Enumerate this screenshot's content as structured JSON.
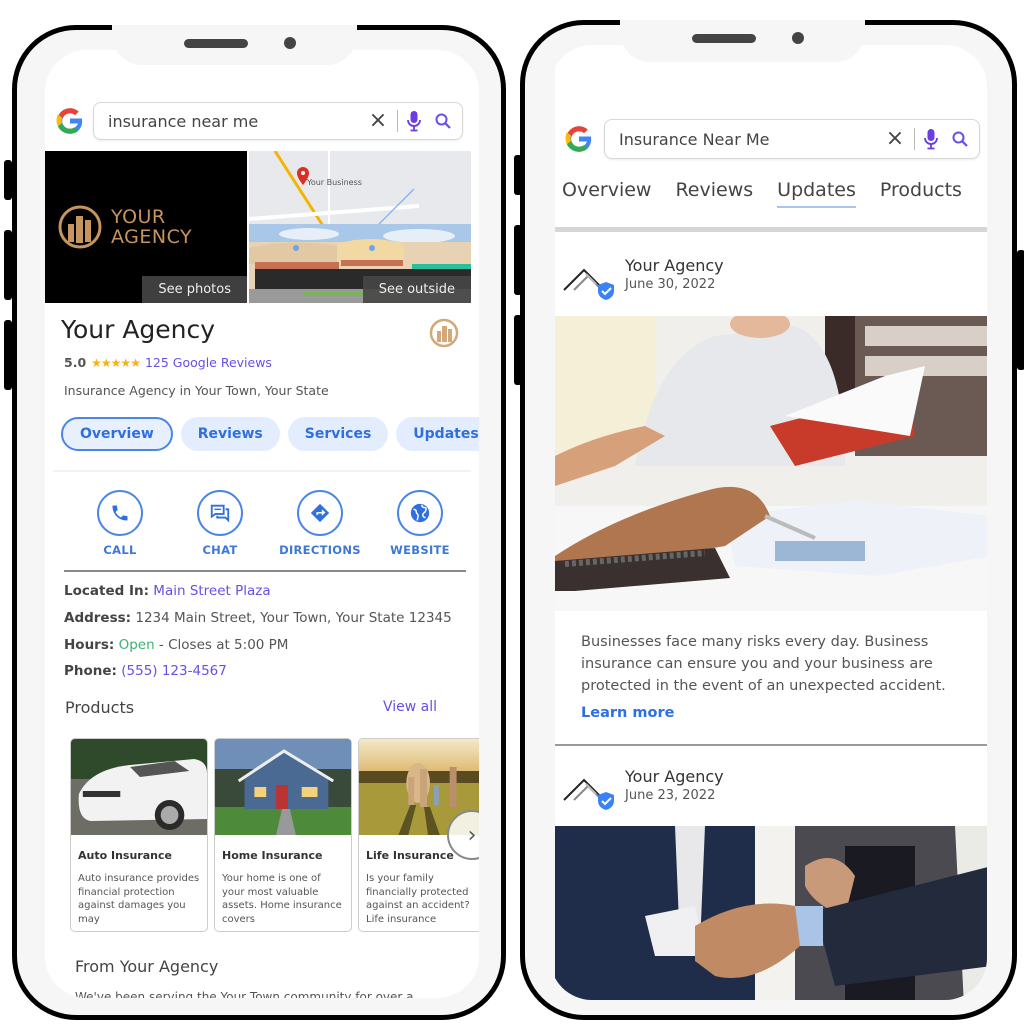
{
  "left_phone": {
    "search": {
      "query": "insurance near me"
    },
    "photos": {
      "logo_line1": "YOUR",
      "logo_line2": "AGENCY",
      "see_photos": "See photos",
      "map_label": "Your Business",
      "see_outside": "See outside"
    },
    "business": {
      "name": "Your Agency",
      "rating": "5.0",
      "stars": 5,
      "stars_text": "★★★★★",
      "reviews_link": "125 Google Reviews",
      "category": "Insurance Agency in Your Town, Your State"
    },
    "chips": [
      {
        "label": "Overview",
        "active": true
      },
      {
        "label": "Reviews",
        "active": false
      },
      {
        "label": "Services",
        "active": false
      },
      {
        "label": "Updates",
        "active": false
      }
    ],
    "actions": [
      {
        "label": "CALL",
        "icon": "phone-icon"
      },
      {
        "label": "CHAT",
        "icon": "chat-icon"
      },
      {
        "label": "DIRECTIONS",
        "icon": "directions-icon"
      },
      {
        "label": "WEBSITE",
        "icon": "globe-icon"
      }
    ],
    "info": {
      "located_label": "Located In:",
      "located_value": "Main Street Plaza",
      "address_label": "Address:",
      "address_value": "1234 Main Street, Your Town, Your State 12345",
      "hours_label": "Hours:",
      "hours_status": "Open",
      "hours_rest": " - Closes at 5:00 PM",
      "phone_label": "Phone:",
      "phone_value": "(555) 123-4567"
    },
    "products": {
      "title": "Products",
      "view_all": "View all",
      "items": [
        {
          "title": "Auto Insurance",
          "desc": "Auto insurance provides financial protection against damages you may"
        },
        {
          "title": "Home Insurance",
          "desc": "Your home is one of your most valuable assets. Home insurance covers"
        },
        {
          "title": "Life Insurance",
          "desc": "Is your family financially protected against an accident? Life insurance"
        }
      ],
      "next_glyph": "›"
    },
    "from_agency": {
      "title": "From Your Agency",
      "text": "We've been serving the Your Town community for over a decade. We were born and raised here, and our mission is to"
    }
  },
  "right_phone": {
    "search": {
      "query": "Insurance Near Me"
    },
    "tabs": [
      {
        "label": "Overview",
        "active": false
      },
      {
        "label": "Reviews",
        "active": false
      },
      {
        "label": "Updates",
        "active": true
      },
      {
        "label": "Products",
        "active": false
      }
    ],
    "posts": [
      {
        "author": "Your Agency",
        "date": "June 30, 2022",
        "text": "Businesses face many risks every day. Business insurance can ensure you and your business are protected in the event of an unexpected accident.",
        "link": "Learn more"
      },
      {
        "author": "Your Agency",
        "date": "June 23, 2022"
      }
    ]
  },
  "colors": {
    "accent_blue": "#2f6fe0",
    "link_purple": "#6a4ee8",
    "open_green": "#3cb371",
    "star_gold": "#f6b11b",
    "logo_gold": "#c6955d"
  }
}
